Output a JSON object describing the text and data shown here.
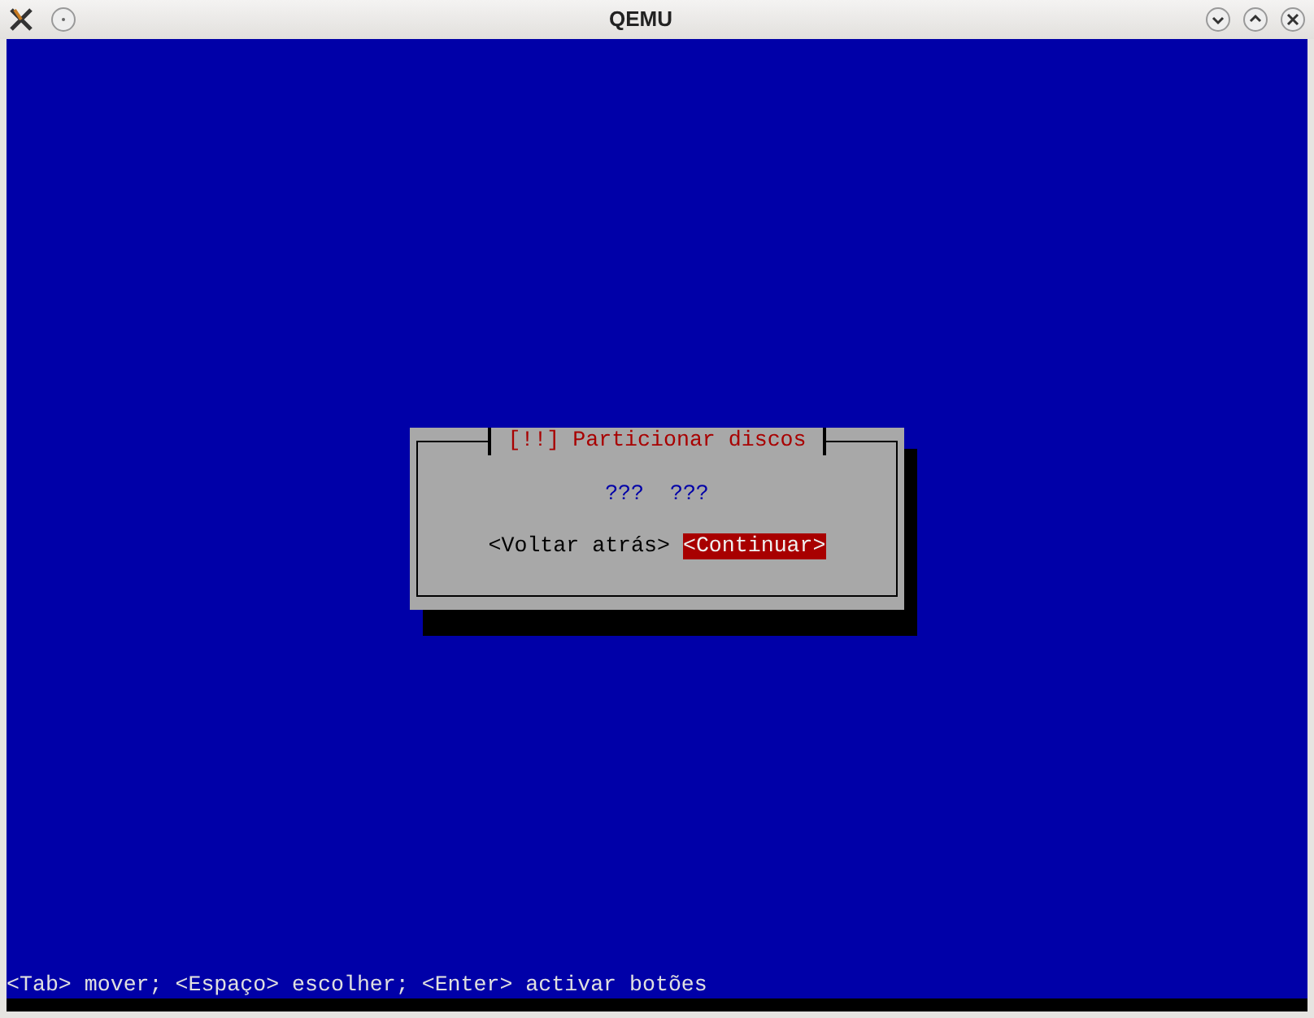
{
  "window": {
    "title": "QEMU"
  },
  "dialog": {
    "title": "[!!] Particionar discos",
    "message": "???  ???",
    "buttons": [
      {
        "label": "<Voltar atrás>",
        "selected": false
      },
      {
        "label": "<Continuar>",
        "selected": true
      }
    ]
  },
  "status_bar": "<Tab> mover; <Espaço> escolher; <Enter> activar botões"
}
